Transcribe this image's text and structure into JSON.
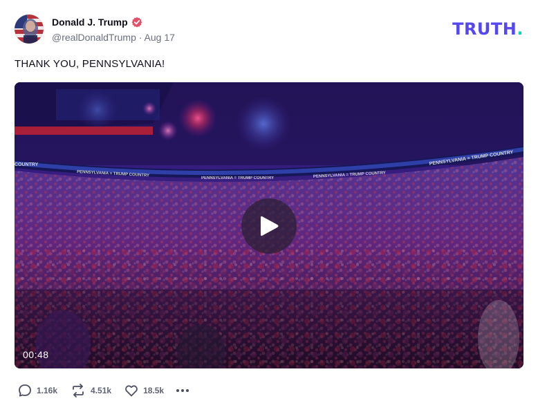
{
  "post": {
    "author": {
      "display_name": "Donald J. Trump",
      "verified": true,
      "handle": "@realDonaldTrump",
      "separator": " · ",
      "date": "Aug 17",
      "avatar_icon": "flag-portrait-avatar"
    },
    "brand": {
      "name": "TRUTH",
      "dot": ".",
      "primary_color": "#5448ee",
      "dot_color": "#0fd5b6"
    },
    "text": "THANK YOU, PENNSYLVANIA!",
    "media": {
      "type": "video",
      "duration": "00:48",
      "play_icon": "play-icon",
      "scene_banner_text": "PENNSYLVANIA = TRUMP COUNTRY",
      "scene_banner_edge_text": "COUNTRY"
    },
    "actions": {
      "reply_count": "1.16k",
      "retruth_count": "4.51k",
      "like_count": "18.5k",
      "reply_icon": "reply-icon",
      "retruth_icon": "retruth-icon",
      "like_icon": "heart-icon",
      "more_icon": "more-icon"
    }
  }
}
